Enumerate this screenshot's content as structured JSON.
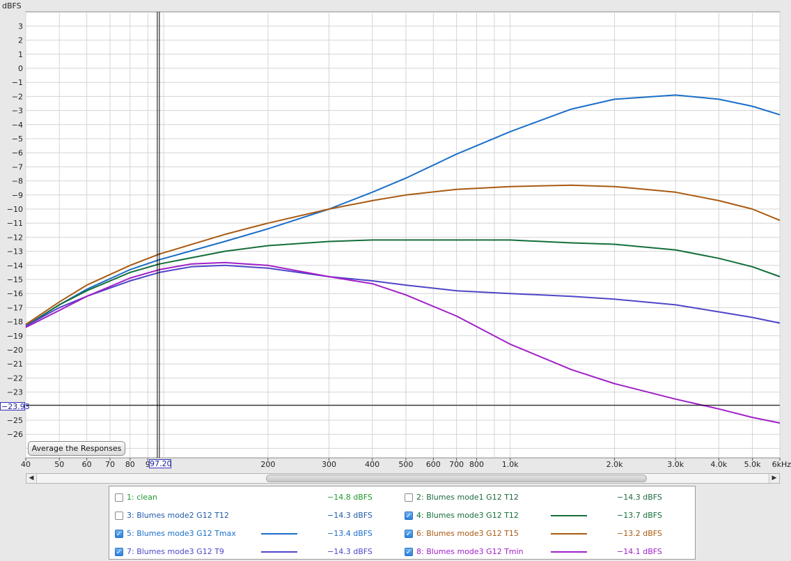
{
  "chart_data": {
    "type": "line",
    "title": "",
    "ylabel": "dBFS",
    "xlabel": "",
    "x_scale": "log",
    "xlim": [
      40,
      6000
    ],
    "ylim": [
      -28,
      4
    ],
    "yticks": [
      3,
      2,
      1,
      0,
      -1,
      -2,
      -3,
      -4,
      -5,
      -6,
      -7,
      -8,
      -9,
      -10,
      -11,
      -12,
      -13,
      -14,
      -15,
      -16,
      -17,
      -18,
      -19,
      -20,
      -21,
      -22,
      -23,
      -25,
      -26
    ],
    "xticks": [
      {
        "v": 40,
        "t": "40"
      },
      {
        "v": 50,
        "t": "50"
      },
      {
        "v": 60,
        "t": "60"
      },
      {
        "v": 70,
        "t": "70"
      },
      {
        "v": 80,
        "t": "80"
      },
      {
        "v": 90,
        "t": "9"
      },
      {
        "v": 200,
        "t": "200"
      },
      {
        "v": 300,
        "t": "300"
      },
      {
        "v": 400,
        "t": "400"
      },
      {
        "v": 500,
        "t": "500"
      },
      {
        "v": 600,
        "t": "600"
      },
      {
        "v": 700,
        "t": "700"
      },
      {
        "v": 800,
        "t": "800"
      },
      {
        "v": 1000,
        "t": "1.0k"
      },
      {
        "v": 2000,
        "t": "2.0k"
      },
      {
        "v": 3000,
        "t": "3.0k"
      },
      {
        "v": 4000,
        "t": "4.0k"
      },
      {
        "v": 5000,
        "t": "5.0k"
      },
      {
        "v": 6000,
        "t": "6kHz"
      }
    ],
    "cursor": {
      "x": 97.2,
      "y": -23.93,
      "x_label": "97.20",
      "y_label": "-23.93"
    },
    "grid": true,
    "series": [
      {
        "name": "5: Blumes mode3 G12 Tmax",
        "color": "#1a6ec8",
        "x": [
          40,
          50,
          60,
          80,
          97.2,
          150,
          200,
          300,
          400,
          500,
          700,
          1000,
          1500,
          2000,
          3000,
          4000,
          5000,
          6000
        ],
        "y": [
          -18.3,
          -16.8,
          -15.7,
          -14.3,
          -13.6,
          -12.3,
          -11.4,
          -10.0,
          -8.8,
          -7.8,
          -6.1,
          -4.5,
          -2.9,
          -2.2,
          -1.9,
          -2.2,
          -2.7,
          -3.3
        ]
      },
      {
        "name": "6: Blumes mode3 G12 T15",
        "color": "#a85a10",
        "x": [
          40,
          50,
          60,
          80,
          97.2,
          150,
          200,
          300,
          400,
          500,
          700,
          1000,
          1500,
          2000,
          3000,
          4000,
          5000,
          6000
        ],
        "y": [
          -18.2,
          -16.6,
          -15.4,
          -14.0,
          -13.2,
          -11.8,
          -11.0,
          -10.0,
          -9.4,
          -9.0,
          -8.6,
          -8.4,
          -8.3,
          -8.4,
          -8.8,
          -9.4,
          -10.0,
          -10.8
        ]
      },
      {
        "name": "4: Blumes mode3 G12 T12",
        "color": "#136e3a",
        "x": [
          40,
          50,
          60,
          80,
          97.2,
          150,
          200,
          300,
          400,
          500,
          700,
          1000,
          1500,
          2000,
          3000,
          4000,
          5000,
          6000
        ],
        "y": [
          -18.3,
          -16.8,
          -15.8,
          -14.5,
          -13.9,
          -13.0,
          -12.6,
          -12.3,
          -12.2,
          -12.2,
          -12.2,
          -12.2,
          -12.4,
          -12.5,
          -12.9,
          -13.5,
          -14.1,
          -14.8
        ]
      },
      {
        "name": "7: Blumes mode3 G12 T9",
        "color": "#4e46c8",
        "x": [
          40,
          50,
          60,
          80,
          97.2,
          120,
          150,
          200,
          300,
          400,
          500,
          700,
          1000,
          1500,
          2000,
          3000,
          4000,
          5000,
          6000
        ],
        "y": [
          -18.3,
          -17.0,
          -16.2,
          -15.1,
          -14.5,
          -14.1,
          -14.0,
          -14.2,
          -14.8,
          -15.1,
          -15.4,
          -15.8,
          -16.0,
          -16.2,
          -16.4,
          -16.8,
          -17.3,
          -17.7,
          -18.1
        ]
      },
      {
        "name": "8: Blumes mode3 G12 Tmin",
        "color": "#a020c8",
        "x": [
          40,
          50,
          60,
          80,
          97.2,
          120,
          150,
          200,
          300,
          400,
          500,
          700,
          1000,
          1500,
          2000,
          3000,
          4000,
          5000,
          6000
        ],
        "y": [
          -18.4,
          -17.2,
          -16.2,
          -14.9,
          -14.3,
          -13.9,
          -13.8,
          -14.0,
          -14.8,
          -15.3,
          -16.1,
          -17.6,
          -19.6,
          -21.4,
          -22.4,
          -23.5,
          -24.2,
          -24.8,
          -25.2
        ]
      }
    ]
  },
  "legend": [
    {
      "name": "1: clean",
      "value": "-14.8 dBFS",
      "checked": false,
      "color": "#1c9a2c"
    },
    {
      "name": "2: Blumes mode1 G12 T12",
      "value": "-14.3 dBFS",
      "checked": false,
      "color": "#1e6a3c"
    },
    {
      "name": "3: Blumes mode2 G12 T12",
      "value": "-14.3 dBFS",
      "checked": false,
      "color": "#1f5aa8"
    },
    {
      "name": "4: Blumes mode3 G12 T12",
      "value": "-13.7 dBFS",
      "checked": true,
      "color": "#136e3a"
    },
    {
      "name": "5: Blumes mode3 G12 Tmax",
      "value": "-13.4 dBFS",
      "checked": true,
      "color": "#1a6ec8"
    },
    {
      "name": "6: Blumes mode3 G12 T15",
      "value": "-13.2 dBFS",
      "checked": true,
      "color": "#a85a10"
    },
    {
      "name": "7: Blumes mode3 G12 T9",
      "value": "-14.3 dBFS",
      "checked": true,
      "color": "#4e46c8"
    },
    {
      "name": "8: Blumes mode3 G12 Tmin",
      "value": "-14.1 dBFS",
      "checked": true,
      "color": "#a020c8"
    }
  ],
  "controls": {
    "average_button": "Average the Responses",
    "scroll_left": "◀",
    "scroll_right": "▶"
  }
}
